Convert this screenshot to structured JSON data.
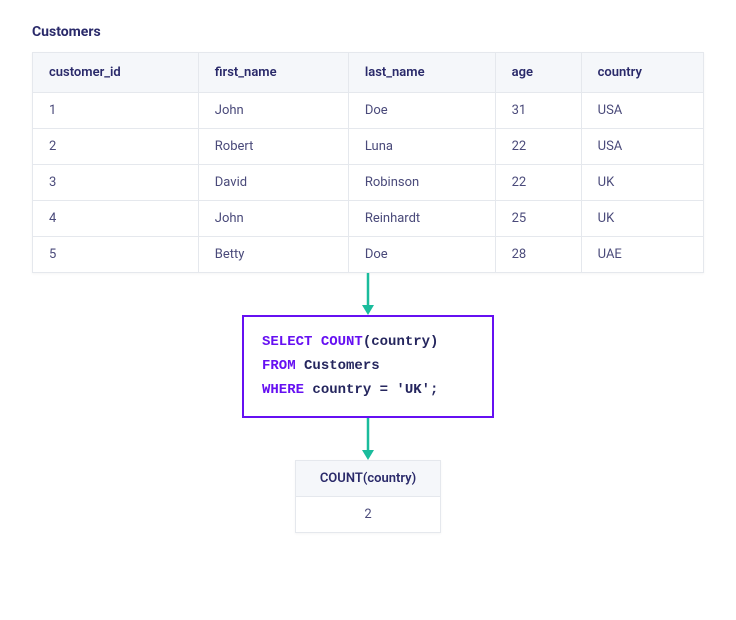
{
  "table": {
    "title": "Customers",
    "headers": [
      "customer_id",
      "first_name",
      "last_name",
      "age",
      "country"
    ],
    "rows": [
      [
        "1",
        "John",
        "Doe",
        "31",
        "USA"
      ],
      [
        "2",
        "Robert",
        "Luna",
        "22",
        "USA"
      ],
      [
        "3",
        "David",
        "Robinson",
        "22",
        "UK"
      ],
      [
        "4",
        "John",
        "Reinhardt",
        "25",
        "UK"
      ],
      [
        "5",
        "Betty",
        "Doe",
        "28",
        "UAE"
      ]
    ]
  },
  "query": {
    "kw_select": "SELECT",
    "fn_count": "COUNT",
    "col": "(country)",
    "kw_from": "FROM",
    "table_name": "Customers",
    "kw_where": "WHERE",
    "cond": "country = 'UK';"
  },
  "result": {
    "header": "COUNT(country)",
    "value": "2"
  },
  "colors": {
    "keyword": "#6610f2",
    "border": "#e5e8ed",
    "arrow": "#1abc9c"
  }
}
